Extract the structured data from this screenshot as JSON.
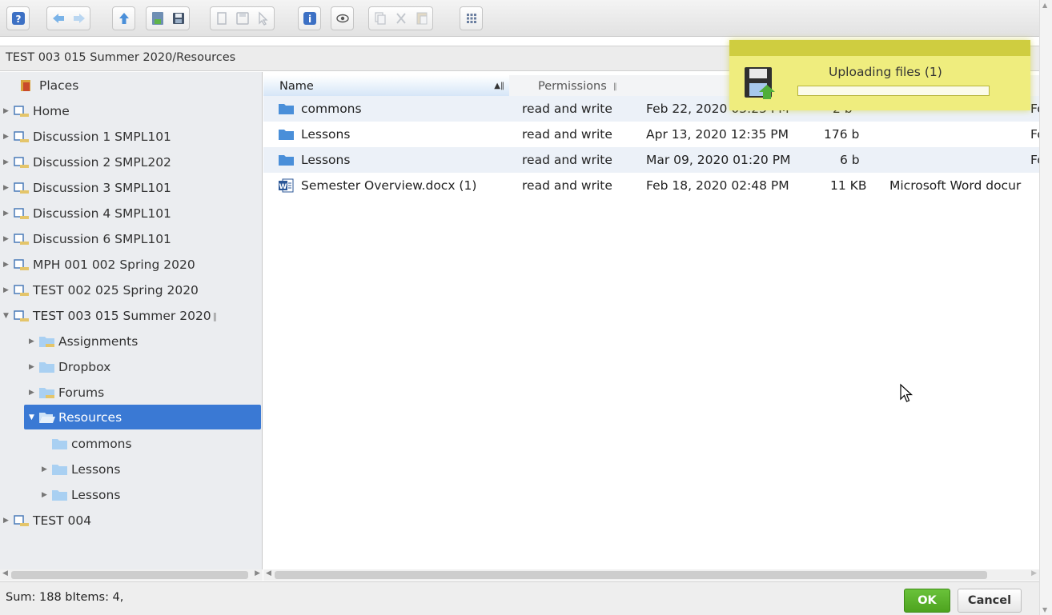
{
  "toolbar": {
    "buttons": [
      {
        "icon": "help-icon"
      },
      {
        "icon": "back-arrow-icon"
      },
      {
        "icon": "forward-arrow-icon"
      },
      {
        "icon": "up-folder-icon"
      },
      {
        "icon": "upload-icon"
      },
      {
        "icon": "save-icon"
      },
      {
        "icon": "new-folder-icon"
      },
      {
        "icon": "disk-icon"
      },
      {
        "icon": "select-icon"
      },
      {
        "icon": "info-icon"
      },
      {
        "icon": "preview-eye-icon"
      },
      {
        "icon": "copy-icon"
      },
      {
        "icon": "cut-icon"
      },
      {
        "icon": "paste-icon"
      },
      {
        "icon": "grid-view-icon"
      }
    ]
  },
  "path": "TEST 003 015 Summer 2020/Resources",
  "sidebar": {
    "places_label": "Places",
    "items": [
      {
        "label": "Home"
      },
      {
        "label": "Discussion 1 SMPL101"
      },
      {
        "label": "Discussion 2 SMPL202"
      },
      {
        "label": "Discussion 3 SMPL101"
      },
      {
        "label": "Discussion 4 SMPL101"
      },
      {
        "label": "Discussion 6 SMPL101"
      },
      {
        "label": "MPH 001 002 Spring 2020"
      },
      {
        "label": "TEST 002 025 Spring 2020"
      },
      {
        "label": "TEST 003 015 Summer 2020"
      },
      {
        "label": "Assignments"
      },
      {
        "label": "Dropbox"
      },
      {
        "label": "Forums"
      },
      {
        "label": "Resources"
      },
      {
        "label": "commons"
      },
      {
        "label": "Lessons"
      },
      {
        "label": "Lessons"
      },
      {
        "label": "TEST 004"
      }
    ]
  },
  "columns": {
    "name": "Name",
    "permissions": "Permissions"
  },
  "files": [
    {
      "name": "commons",
      "permissions": "read and write",
      "date": "Feb 22, 2020 03:25 PM",
      "size": "2 b",
      "kind": "Fo"
    },
    {
      "name": "Lessons",
      "permissions": "read and write",
      "date": "Apr 13, 2020 12:35 PM",
      "size": "176 b",
      "kind": "Fo"
    },
    {
      "name": "Lessons",
      "permissions": "read and write",
      "date": "Mar 09, 2020 01:20 PM",
      "size": "6 b",
      "kind": "Fo"
    },
    {
      "name": "Semester Overview.docx (1)",
      "permissions": "read and write",
      "date": "Feb 18, 2020 02:48 PM",
      "size": "11 KB",
      "kind": "Microsoft Word docur"
    }
  ],
  "upload": {
    "title": "Uploading files (1)",
    "progress": 0
  },
  "status": {
    "text": "Sum: 188 bItems: 4,",
    "ok_label": "OK",
    "cancel_label": "Cancel"
  },
  "colors": {
    "selection": "#3a79d4",
    "ok_green": "#4ea31f",
    "upload_yellow": "#efed7e",
    "folder_blue": "#4a8fd9"
  }
}
